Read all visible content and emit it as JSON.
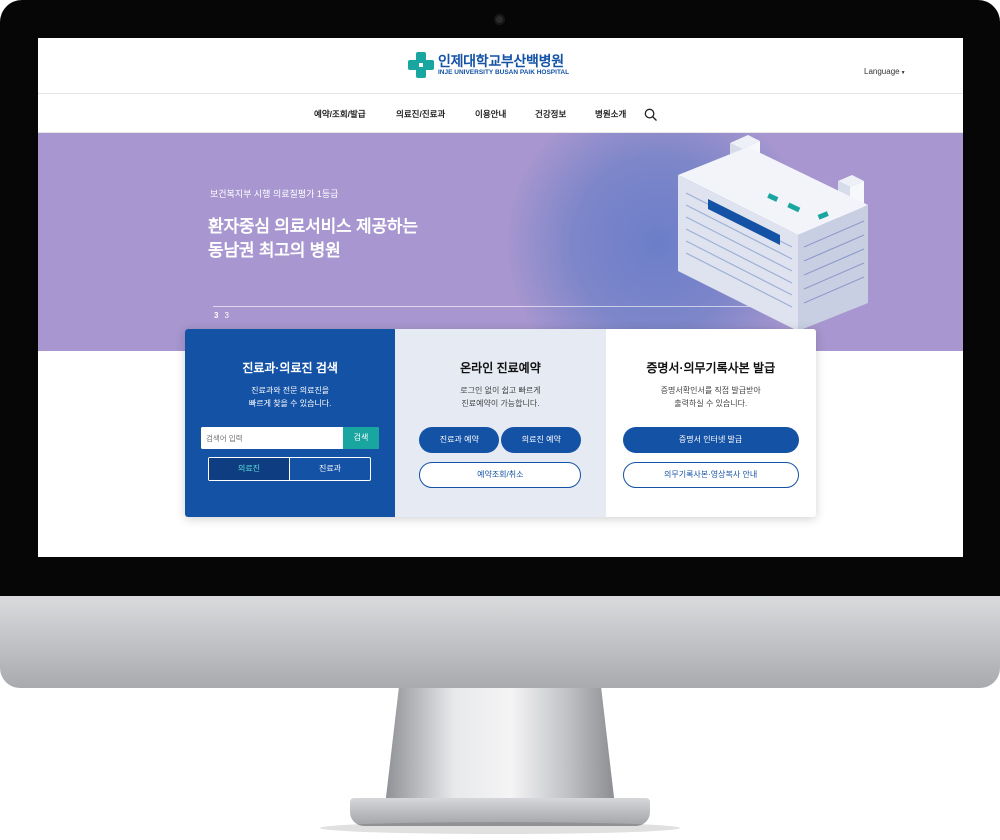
{
  "site": {
    "logo_ko": "인제대학교부산백병원",
    "logo_en": "INJE UNIVERSITY BUSAN PAIK HOSPITAL",
    "language": "Language"
  },
  "nav": {
    "items": [
      "예약/조회/발급",
      "의료진/진료과",
      "이용안내",
      "건강정보",
      "병원소개"
    ],
    "search_icon": "search-icon"
  },
  "hero": {
    "subtitle": "보건복지부 시행 의료질평가 1등급",
    "title_line1": "환자중심 의료서비스 제공하는",
    "title_line2": "동남권 최고의 병원",
    "page_current": "3",
    "page_total": "3"
  },
  "panels": {
    "search": {
      "title": "진료과·의료진 검색",
      "desc_line1": "진료과와 전문 의료진을",
      "desc_line2": "빠르게 찾을 수 있습니다.",
      "placeholder": "검색어 입력",
      "search_label": "검색",
      "toggle_doctor": "의료진",
      "toggle_dept": "진료과"
    },
    "reserve": {
      "title": "온라인 진료예약",
      "desc_line1": "로그인 없이 쉽고 빠르게",
      "desc_line2": "진료예약이 가능합니다.",
      "btn_dept": "진료과 예약",
      "btn_doctor": "의료진 예약",
      "btn_check": "예약조회/취소"
    },
    "cert": {
      "title": "증명서·의무기록사본 발급",
      "desc_line1": "증명서확인서를 직접 발급받아",
      "desc_line2": "출력하실 수 있습니다.",
      "btn_issue": "증명서 인터넷 발급",
      "btn_guide": "의무기록사본·영상복사 안내"
    }
  },
  "colors": {
    "brand_blue": "#1452a6",
    "teal": "#1aa6a0",
    "hero_purple": "#a796cf"
  }
}
